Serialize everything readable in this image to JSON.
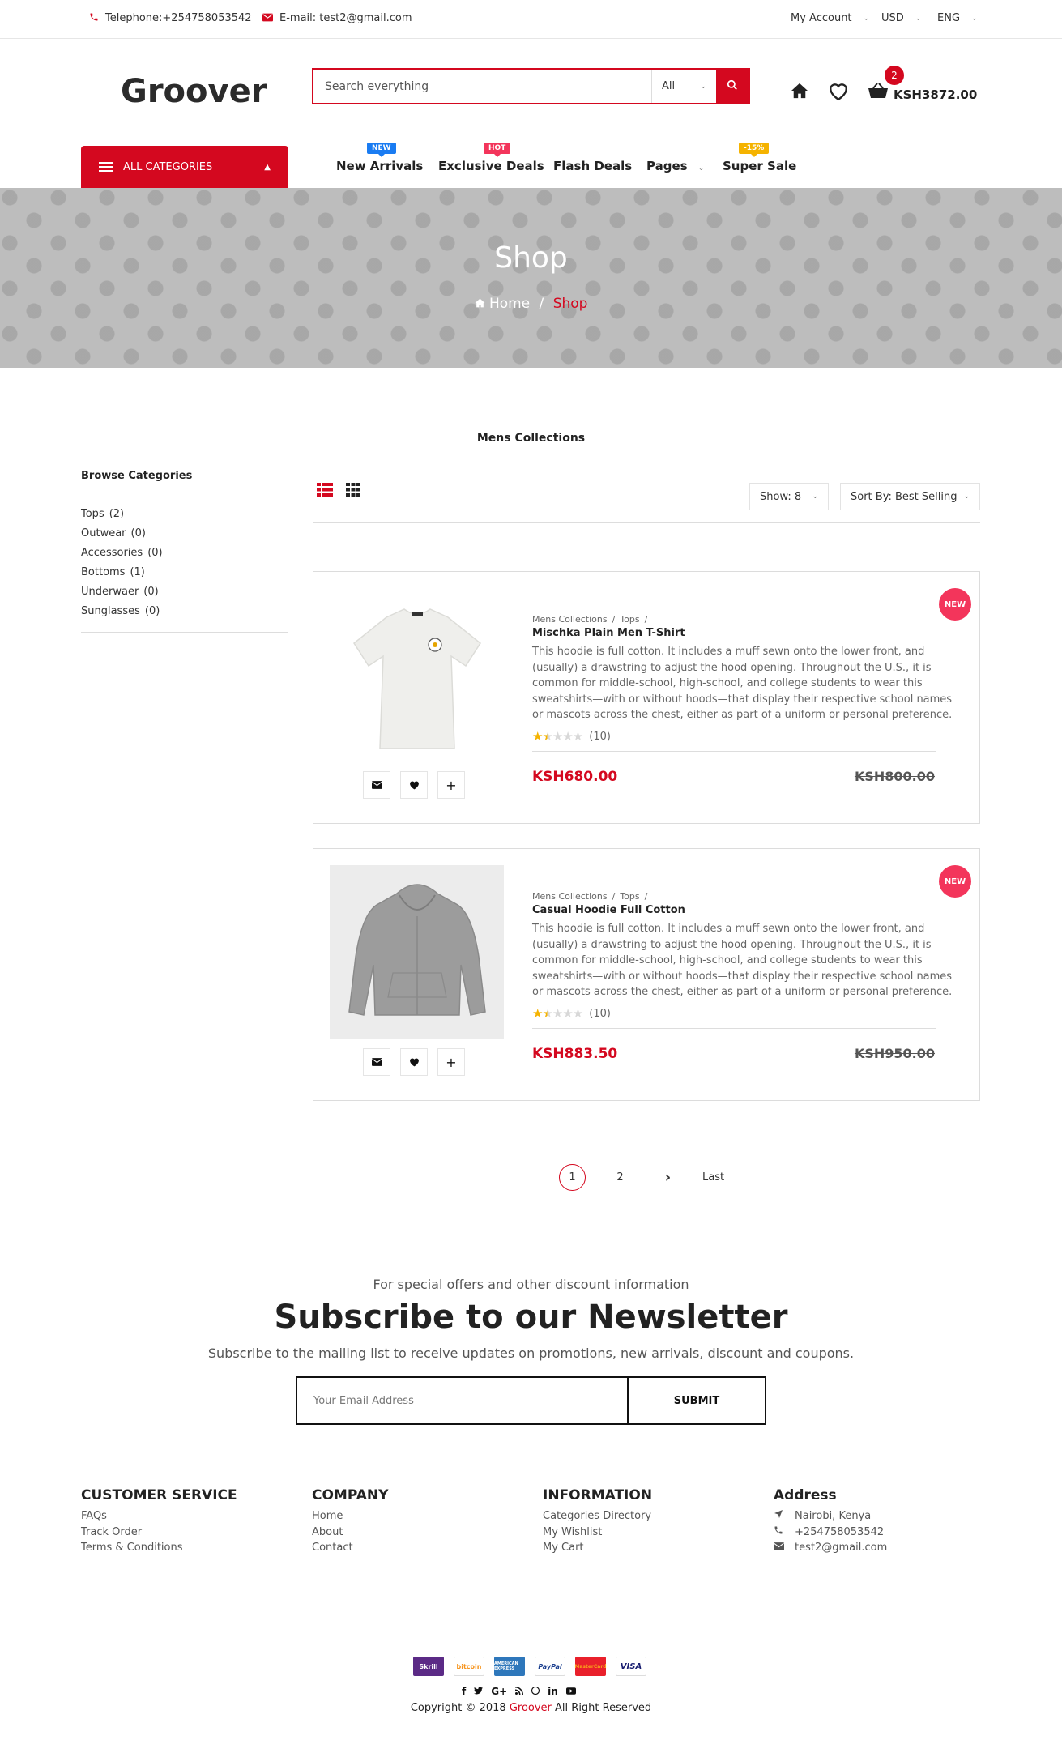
{
  "topbar": {
    "telephone": "Telephone:+254758053542",
    "email": "E-mail: test2@gmail.com",
    "my_account": "My Account",
    "currency": "USD",
    "language": "ENG"
  },
  "header": {
    "logo": "Groover",
    "search_placeholder": "Search everything",
    "search_category": "All",
    "cart_count": "2",
    "cart_total": "KSH3872.00"
  },
  "nav": {
    "all_categories": "ALL CATEGORIES",
    "items": [
      {
        "label": "New Arrivals",
        "badge": "NEW",
        "badge_color": "#1a7cf2"
      },
      {
        "label": "Exclusive Deals",
        "badge": "HOT",
        "badge_color": "#f3355b"
      },
      {
        "label": "Flash Deals",
        "badge": ""
      },
      {
        "label": "Pages",
        "badge": ""
      },
      {
        "label": "Super Sale",
        "badge": "-15%",
        "badge_color": "#f5b300"
      }
    ]
  },
  "banner": {
    "title": "Shop",
    "breadcrumb_home": "Home",
    "breadcrumb_current": "Shop"
  },
  "collection_title": "Mens Collections",
  "sidebar": {
    "title": "Browse Categories",
    "categories": [
      {
        "name": "Tops",
        "count": "(2)"
      },
      {
        "name": "Outwear",
        "count": "(0)"
      },
      {
        "name": "Accessories",
        "count": "(0)"
      },
      {
        "name": "Bottoms",
        "count": "(1)"
      },
      {
        "name": "Underwaer",
        "count": "(0)"
      },
      {
        "name": "Sunglasses",
        "count": "(0)"
      }
    ]
  },
  "toolbar": {
    "show": "Show: 8",
    "sort": "Sort By: Best Selling"
  },
  "products": [
    {
      "crumb_1": "Mens Collections",
      "crumb_2": "Tops",
      "crumb_sep": "/",
      "name": "Mischka Plain Men T-Shirt",
      "description": "This hoodie is full cotton. It includes a muff sewn onto the lower front, and (usually) a drawstring to adjust the hood opening. Throughout the U.S., it is common for middle-school, high-school, and college students to wear this sweatshirts—with or without hoods—that display their respective school names or mascots across the chest, either as part of a uniform or personal preference.",
      "rating": 1.5,
      "reviews": "(10)",
      "price": "KSH680.00",
      "old_price": "KSH800.00",
      "badge": "NEW"
    },
    {
      "crumb_1": "Mens Collections",
      "crumb_2": "Tops",
      "crumb_sep": "/",
      "name": "Casual Hoodie Full Cotton",
      "description": "This hoodie is full cotton. It includes a muff sewn onto the lower front, and (usually) a drawstring to adjust the hood opening. Throughout the U.S., it is common for middle-school, high-school, and college students to wear this sweatshirts—with or without hoods—that display their respective school names or mascots across the chest, either as part of a uniform or personal preference.",
      "rating": 1.5,
      "reviews": "(10)",
      "price": "KSH883.50",
      "old_price": "KSH950.00",
      "badge": "NEW"
    }
  ],
  "pagination": {
    "current": "1",
    "next_page": "2",
    "next_arrow": "›",
    "last": "Last"
  },
  "newsletter": {
    "pre": "For special offers and other discount information",
    "title": "Subscribe to our Newsletter",
    "subtitle": "Subscribe to the mailing list to receive updates on promotions, new arrivals, discount and coupons.",
    "placeholder": "Your Email Address",
    "button": "SUBMIT"
  },
  "footer": {
    "customer_service": {
      "title": "CUSTOMER SERVICE",
      "links": [
        "FAQs",
        "Track Order",
        "Terms & Conditions"
      ]
    },
    "company": {
      "title": "COMPANY",
      "links": [
        "Home",
        "About",
        "Contact"
      ]
    },
    "information": {
      "title": "INFORMATION",
      "links": [
        "Categories Directory",
        "My Wishlist",
        "My Cart"
      ]
    },
    "address": {
      "title": "Address",
      "location": "Nairobi, Kenya",
      "phone": "+254758053542",
      "email": "test2@gmail.com"
    },
    "payments": [
      "Skrill",
      "bitcoin",
      "AMERICAN EXPRESS",
      "PayPal",
      "MasterCard",
      "VISA"
    ],
    "socials": [
      "f",
      "t",
      "G+",
      "rss",
      "p",
      "in",
      "yt"
    ],
    "copyright_prefix": "Copyright © 2018 ",
    "copyright_brand": "Groover",
    "copyright_suffix": " All Right Reserved"
  },
  "colors": {
    "accent": "#d4081f",
    "new_badge": "#f3355b",
    "star": "#f5b300"
  }
}
